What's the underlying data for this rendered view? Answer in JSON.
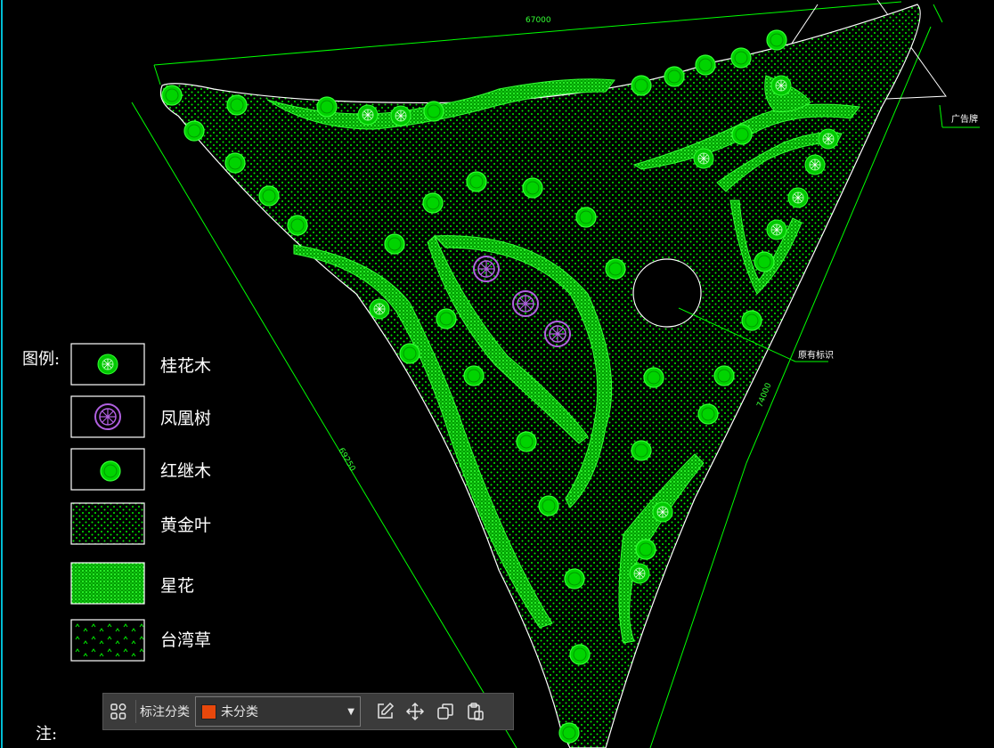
{
  "drawing": {
    "dimensions": {
      "top": "67000",
      "left": "69250",
      "right": "74000"
    },
    "callouts": {
      "billboard": "广告牌",
      "existing_sign": "原有标识"
    },
    "legend_title": "图例:",
    "legend": [
      {
        "label": "桂花木",
        "icon": "osmanthus-tree-symbol"
      },
      {
        "label": "凤凰树",
        "icon": "phoenix-tree-symbol"
      },
      {
        "label": "红继木",
        "icon": "loropetalum-shrub-symbol"
      },
      {
        "label": "黄金叶",
        "icon": "dot-hatch-pattern"
      },
      {
        "label": "星花",
        "icon": "dense-hatch-pattern"
      },
      {
        "label": "台湾草",
        "icon": "grass-hatch-pattern"
      }
    ],
    "note_label": "注:",
    "colors": {
      "line": "#00ff00",
      "accent_purple": "#a855f7",
      "background": "#000000"
    }
  },
  "toolbar": {
    "annotation_label": "标注分类",
    "category_value": "未分类",
    "category_color": "#e8480c",
    "icons": [
      "grid-apps-icon",
      "edit-icon",
      "move-icon",
      "copy-icon",
      "paste-icon"
    ]
  }
}
